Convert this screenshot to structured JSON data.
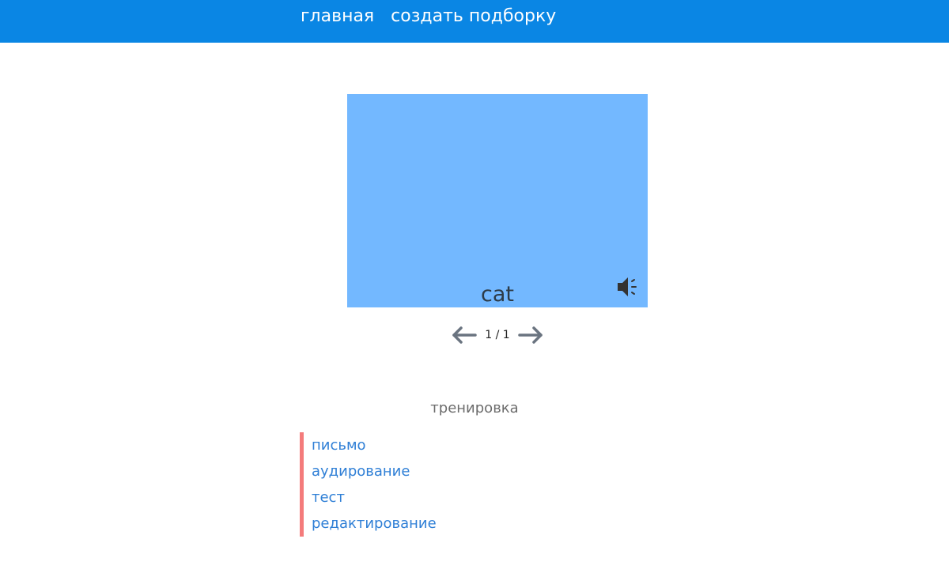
{
  "nav": {
    "home": "главная",
    "create": "создать подборку"
  },
  "card": {
    "word": "cat",
    "sound_icon": "speaker-volume-icon",
    "color": "#73b8ff"
  },
  "pager": {
    "prev_icon": "arrow-left-icon",
    "next_icon": "arrow-right-icon",
    "count": "1 / 1"
  },
  "training": {
    "title": "тренировка",
    "items": [
      "письмо",
      "аудирование",
      "тест",
      "редактирование"
    ]
  },
  "colors": {
    "header": "#0a86e4",
    "accent_border": "#f47b7b",
    "link": "#2f7fd6"
  }
}
